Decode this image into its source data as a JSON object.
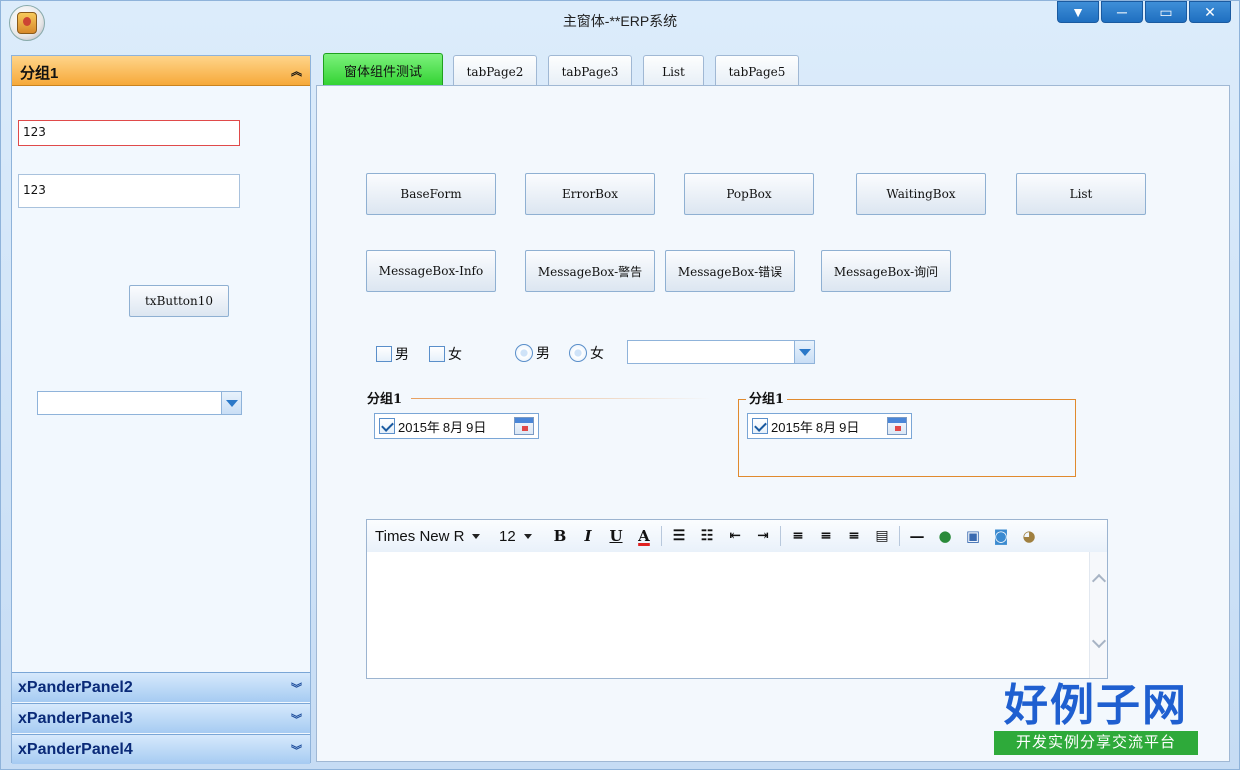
{
  "window": {
    "title": "主窗体-**ERP系统"
  },
  "leftpane": {
    "group1_title": "分组1",
    "textbox1_value": "123",
    "textbox2_value": "123",
    "button_label": "txButton10",
    "xpanders": [
      "xPanderPanel2",
      "xPanderPanel3",
      "xPanderPanel4"
    ]
  },
  "tabs": [
    "窗体组件测试",
    "tabPage2",
    "tabPage3",
    "List",
    "tabPage5"
  ],
  "buttons_row1": [
    "BaseForm",
    "ErrorBox",
    "PopBox",
    "WaitingBox",
    "List"
  ],
  "buttons_row2": [
    "MessageBox-Info",
    "MessageBox-警告",
    "MessageBox-错误",
    "MessageBox-询问"
  ],
  "checkboxes": [
    "男",
    "女"
  ],
  "radios": [
    "男",
    "女"
  ],
  "groupbox1": {
    "title": "分组1",
    "date_year": "2015年",
    "date_month": "8月",
    "date_day": "9日"
  },
  "groupbox2": {
    "title": "分组1",
    "date_year": "2015年",
    "date_month": "8月",
    "date_day": "9日"
  },
  "editor": {
    "font": "Times New R",
    "size": "12"
  },
  "watermark": {
    "brand": "好例子网",
    "slogan": "开发实例分享交流平台"
  },
  "colors": {
    "accent_orange": "#f6a93a",
    "active_tab_green": "#2fd12f",
    "panel_blue": "#a6cbf2"
  }
}
